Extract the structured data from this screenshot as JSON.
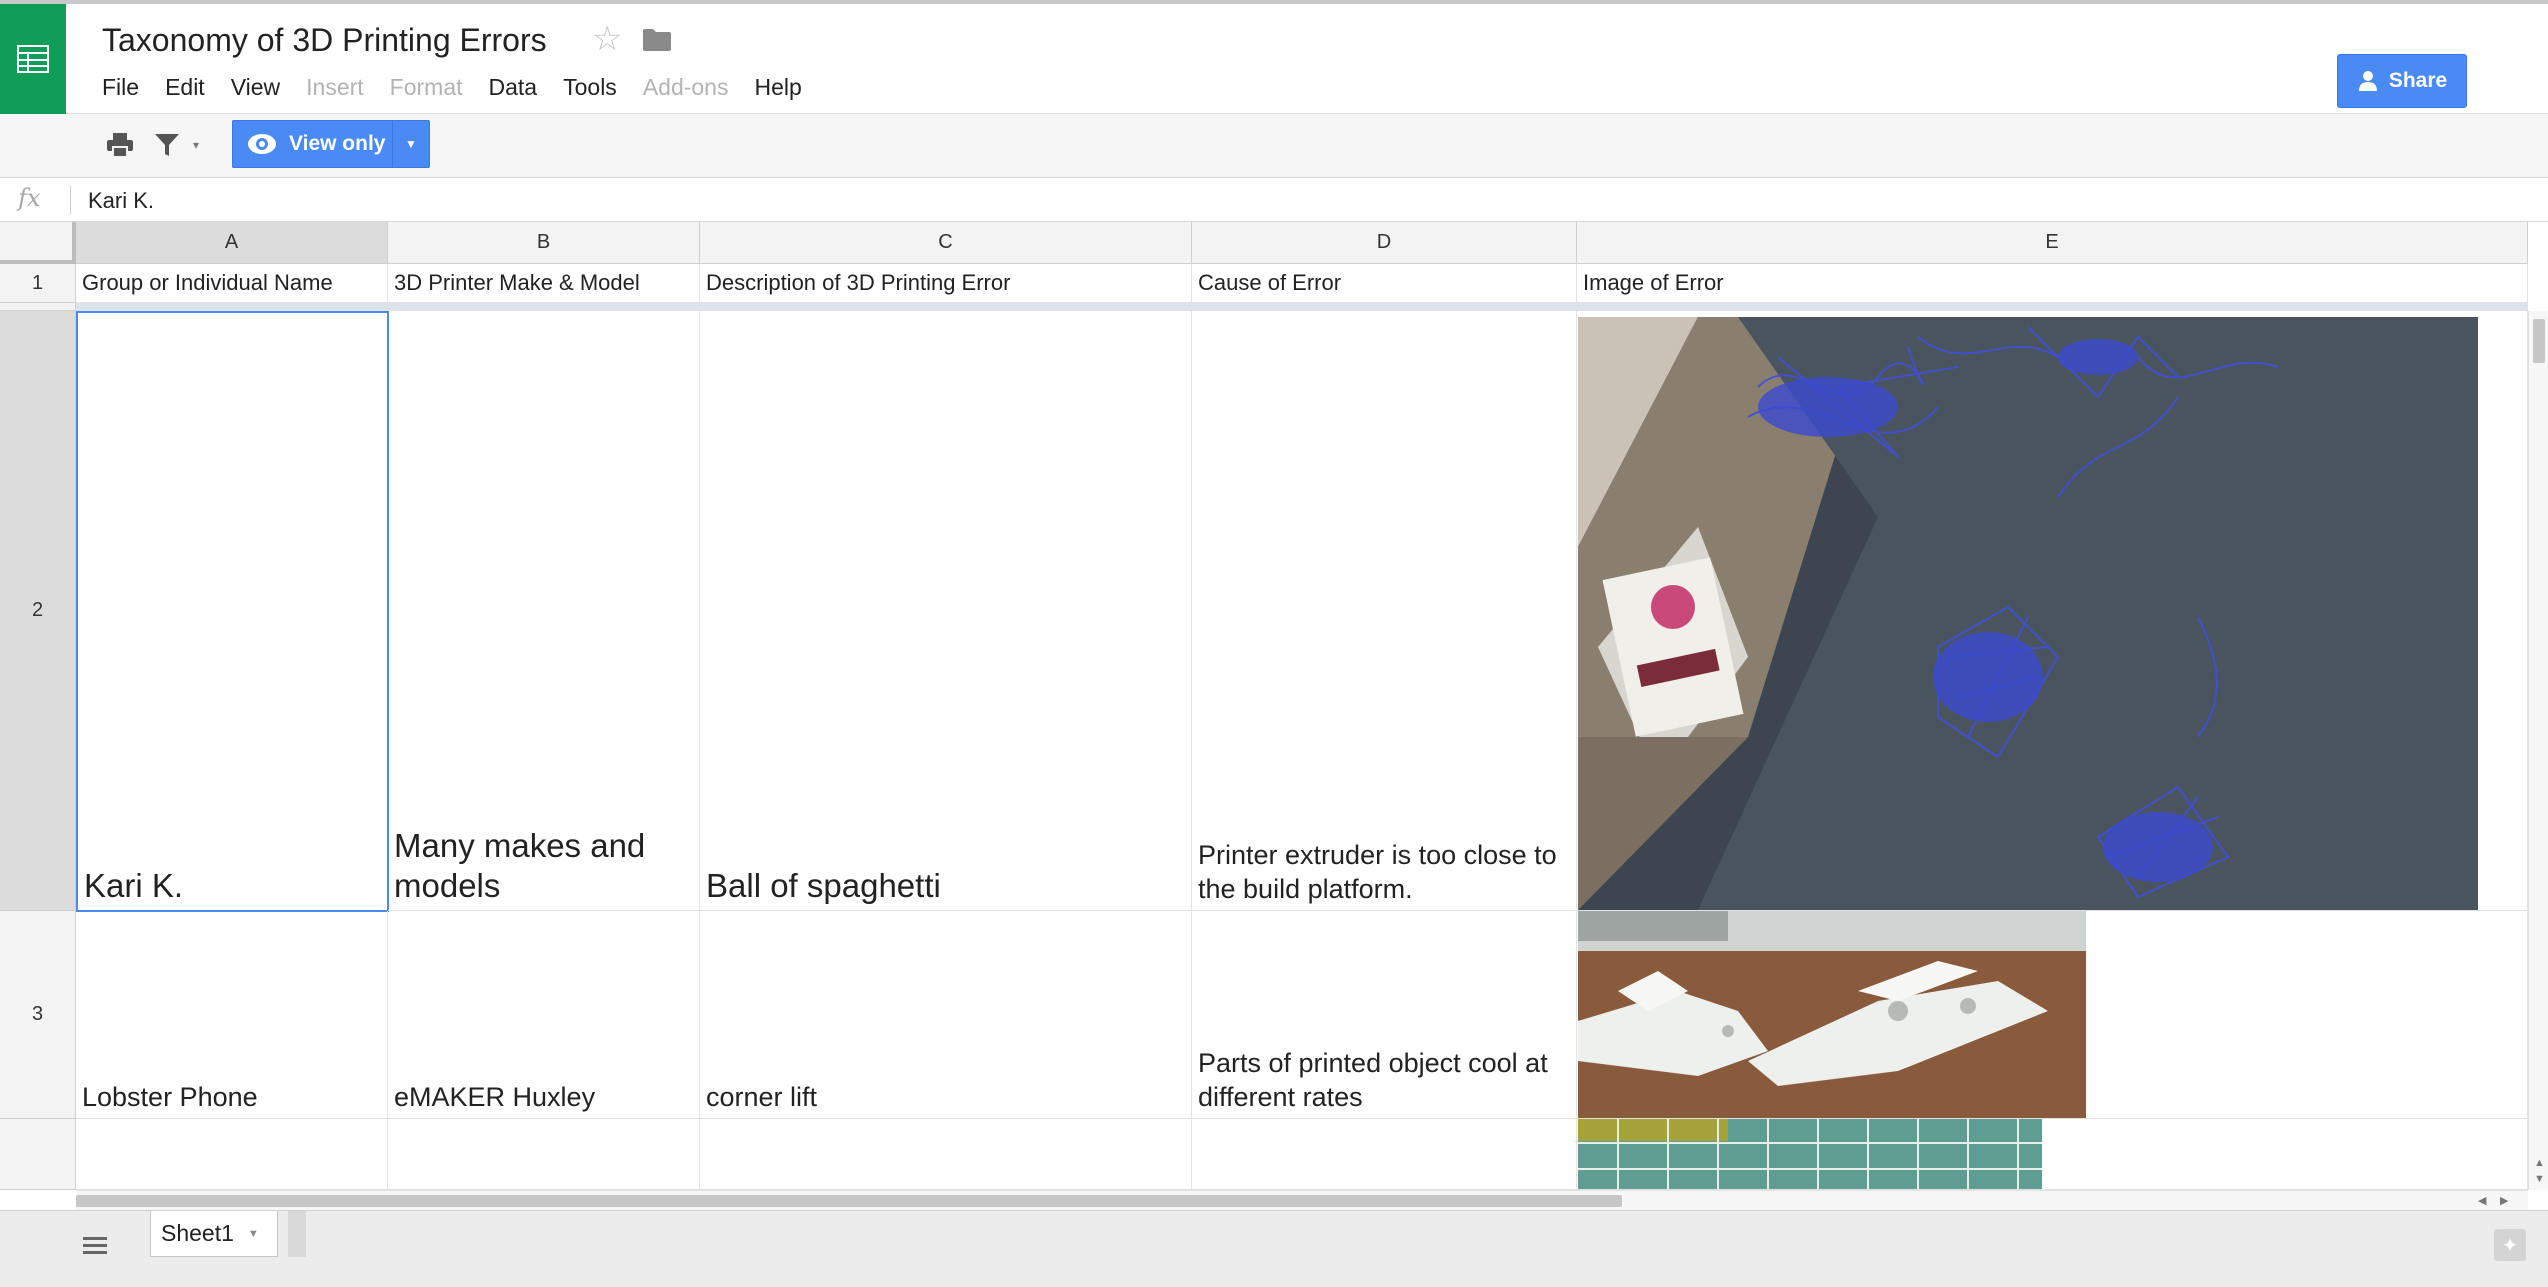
{
  "app": {
    "title": "Taxonomy of 3D Printing Errors",
    "icons": [
      "sheets-logo-icon",
      "star-icon",
      "folder-icon",
      "print-icon",
      "filter-icon",
      "eye-icon",
      "share-person-icon",
      "all-sheets-icon",
      "explore-icon"
    ]
  },
  "menu": {
    "items": [
      {
        "label": "File",
        "enabled": true
      },
      {
        "label": "Edit",
        "enabled": true
      },
      {
        "label": "View",
        "enabled": true
      },
      {
        "label": "Insert",
        "enabled": false
      },
      {
        "label": "Format",
        "enabled": false
      },
      {
        "label": "Data",
        "enabled": true
      },
      {
        "label": "Tools",
        "enabled": true
      },
      {
        "label": "Add-ons",
        "enabled": false
      },
      {
        "label": "Help",
        "enabled": true
      }
    ]
  },
  "toolbar": {
    "share_label": "Share",
    "view_only_label": "View only"
  },
  "formula_bar": {
    "fx_label": "fx",
    "value": "Kari K."
  },
  "grid": {
    "columns": [
      "A",
      "B",
      "C",
      "D",
      "E"
    ],
    "selected_column": "A",
    "rows": [
      "1",
      "2",
      "3",
      ""
    ],
    "selected_row": "2",
    "header_row": [
      "Group or Individual Name",
      "3D Printer Make & Model",
      "Description of 3D Printing Error",
      "Cause of Error",
      "Image of Error"
    ],
    "data_rows": [
      {
        "name": "Kari K.",
        "printer": "Many makes and models",
        "description": "Ball of spaghetti",
        "cause": "Printer extruder is too close to the build platform.",
        "image": "blue filament spaghetti photo"
      },
      {
        "name": "Lobster Phone",
        "printer": "eMAKER Huxley",
        "description": "corner lift",
        "cause": "Parts of printed object cool at different rates",
        "image": "white printed parts with lifted corners photo"
      }
    ]
  },
  "sheets": {
    "tabs": [
      {
        "label": "Sheet1",
        "active": true
      }
    ]
  },
  "colors": {
    "brand_green": "#0f9d58",
    "accent_blue": "#4a8af4",
    "selection_blue": "#4a8af4"
  }
}
